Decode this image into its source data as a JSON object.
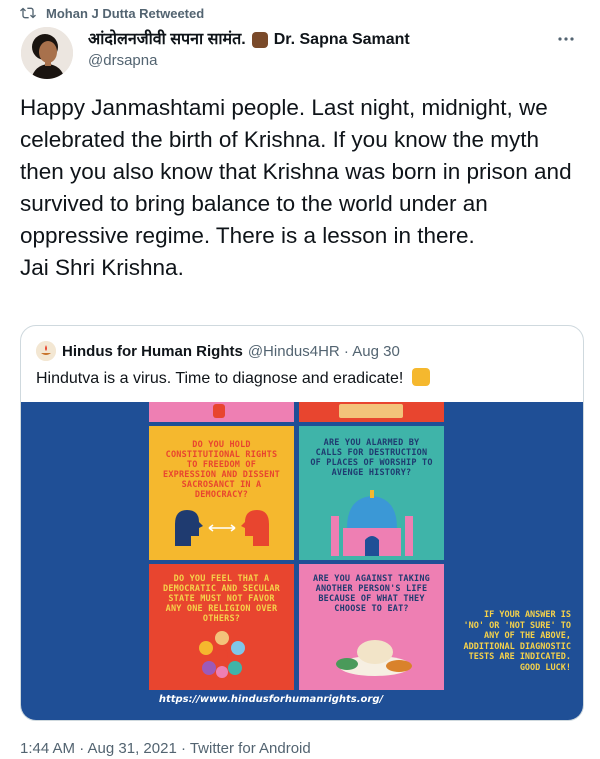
{
  "retweet": {
    "text": "Mohan J Dutta Retweeted",
    "icon": "retweet-icon"
  },
  "author": {
    "name_devanagari": "आंदोलनजीवी सपना सामंत.",
    "name_latin": "Dr. Sapna Samant",
    "handle": "@drsapna"
  },
  "tweet": {
    "text": "Happy Janmashtami people. Last night, midnight, we celebrated the birth of Krishna. If you know the myth then you also know that Krishna was born in prison and survived to bring balance to the world under an oppressive regime. There is a lesson in there.\nJai Shri Krishna.",
    "timestamp": "1:44 AM · Aug 31, 2021 · Twitter for Android"
  },
  "quoted": {
    "name": "Hindus for Human Rights",
    "handle_meta": "@Hindus4HR · Aug 30",
    "text": "Hindutva is a virus. Time to diagnose and eradicate!",
    "image": {
      "panel_1": "DO YOU HOLD CONSTITUTIONAL RIGHTS TO FREEDOM OF EXPRESSION AND DISSENT SACROSANCT IN A DEMOCRACY?",
      "panel_2": "ARE YOU ALARMED BY CALLS FOR DESTRUCTION OF PLACES OF WORSHIP TO AVENGE HISTORY?",
      "panel_3": "DO YOU FEEL THAT A DEMOCRATIC AND SECULAR STATE MUST NOT FAVOR ANY ONE RELIGION OVER OTHERS?",
      "panel_4": "ARE YOU AGAINST TAKING ANOTHER PERSON'S LIFE BECAUSE OF WHAT THEY CHOOSE TO EAT?",
      "side_note": "IF YOUR ANSWER IS 'NO' OR 'NOT SURE' TO ANY OF THE ABOVE, ADDITIONAL DIAGNOSTIC TESTS ARE INDICATED. GOOD LUCK!",
      "url": "https://www.hindusforhumanrights.org/"
    }
  },
  "colors": {
    "panel_yellow": "#f5b82e",
    "panel_teal": "#3fb4a9",
    "panel_red": "#e8452f",
    "panel_pink": "#ee7fb3",
    "media_blue": "#1f4f96"
  }
}
